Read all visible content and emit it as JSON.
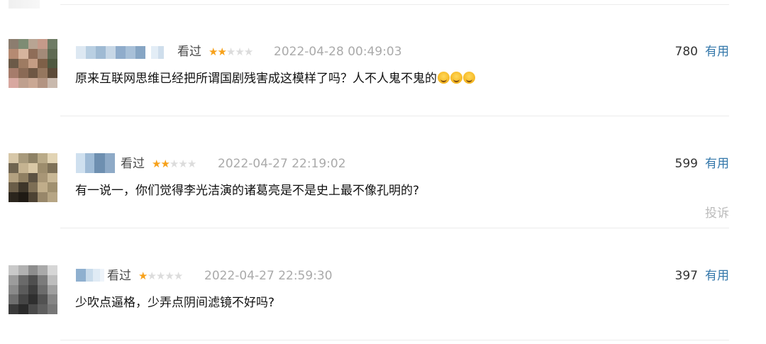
{
  "comments": [
    {
      "status": "看过",
      "rating": 2,
      "max_rating": 5,
      "time": "2022-04-28 00:49:03",
      "votes": "780",
      "useful_label": "有用",
      "content": "原来互联网思维已经把所谓国剧残害成这模样了吗？人不人鬼不鬼的",
      "emoji_count": 3,
      "emoji_icon": "grinning-sweat-face-icon"
    },
    {
      "status": "看过",
      "rating": 2,
      "max_rating": 5,
      "time": "2022-04-27 22:19:02",
      "votes": "599",
      "useful_label": "有用",
      "content": "有一说一，你们觉得李光洁演的诸葛亮是不是史上最不像孔明的?",
      "report_label": "投诉"
    },
    {
      "status": "看过",
      "rating": 1,
      "max_rating": 5,
      "time": "2022-04-27 22:59:30",
      "votes": "397",
      "useful_label": "有用",
      "content": "少吹点逼格，少弄点阴间滤镜不好吗?"
    }
  ],
  "colors": {
    "link": "#3377aa",
    "star_on": "#f7a11a",
    "star_off": "#dcdcdc",
    "timestamp": "#aaaaaa"
  }
}
